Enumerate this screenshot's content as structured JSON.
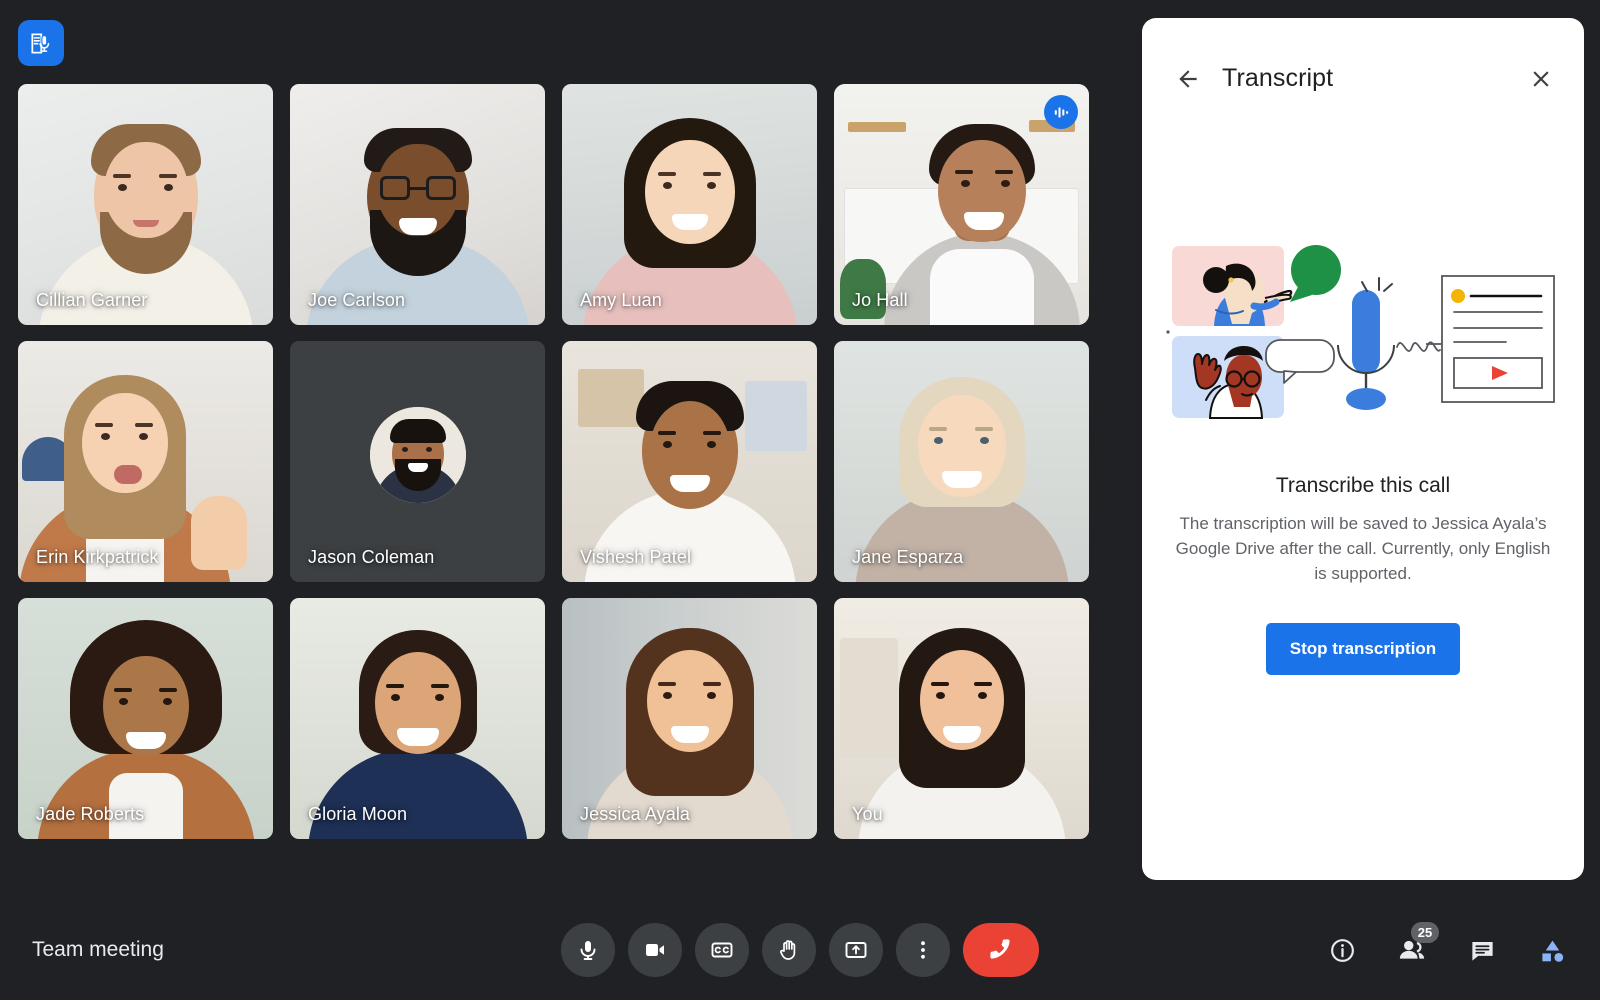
{
  "app": {
    "meeting_title": "Team meeting",
    "recording_indicator_icon": "transcription-record-icon",
    "background_color": "#202124",
    "accent_color": "#1a73e8",
    "speaking_highlight_color": "#8ab4f8",
    "hangup_color": "#ea4335"
  },
  "grid": {
    "participants": [
      {
        "name": "Cillian Garner",
        "camera_on": true,
        "speaking": false
      },
      {
        "name": "Joe Carlson",
        "camera_on": true,
        "speaking": false
      },
      {
        "name": "Amy Luan",
        "camera_on": true,
        "speaking": false
      },
      {
        "name": "Jo Hall",
        "camera_on": true,
        "speaking": true
      },
      {
        "name": "Erin Kirkpatrick",
        "camera_on": true,
        "speaking": false
      },
      {
        "name": "Jason Coleman",
        "camera_on": false,
        "speaking": false
      },
      {
        "name": "Vishesh Patel",
        "camera_on": true,
        "speaking": false
      },
      {
        "name": "Jane Esparza",
        "camera_on": true,
        "speaking": false
      },
      {
        "name": "Jade Roberts",
        "camera_on": true,
        "speaking": false
      },
      {
        "name": "Gloria Moon",
        "camera_on": true,
        "speaking": false
      },
      {
        "name": "Jessica Ayala",
        "camera_on": true,
        "speaking": false
      },
      {
        "name": "You",
        "camera_on": true,
        "speaking": false
      }
    ]
  },
  "controls": {
    "center": [
      {
        "icon": "microphone-icon",
        "label": "Turn off microphone"
      },
      {
        "icon": "video-camera-icon",
        "label": "Turn off camera"
      },
      {
        "icon": "closed-captions-icon",
        "label": "Turn on captions"
      },
      {
        "icon": "raise-hand-icon",
        "label": "Raise hand"
      },
      {
        "icon": "present-screen-icon",
        "label": "Present now"
      },
      {
        "icon": "more-options-icon",
        "label": "More options"
      },
      {
        "icon": "hangup-phone-icon",
        "label": "Leave call"
      }
    ],
    "right": [
      {
        "icon": "info-icon",
        "label": "Meeting details",
        "badge": ""
      },
      {
        "icon": "people-icon",
        "label": "Show everyone",
        "badge": "25"
      },
      {
        "icon": "chat-icon",
        "label": "Chat with everyone",
        "badge": ""
      },
      {
        "icon": "activities-icon",
        "label": "Activities",
        "badge": ""
      }
    ]
  },
  "transcript_panel": {
    "back_icon": "back-arrow-icon",
    "title": "Transcript",
    "close_icon": "close-icon",
    "illustration": "transcription-illustration",
    "heading": "Transcribe this call",
    "description": "The transcription will be saved to Jessica Ayala’s Google Drive after the call. Currently, only English is supported.",
    "button_label": "Stop transcription"
  }
}
